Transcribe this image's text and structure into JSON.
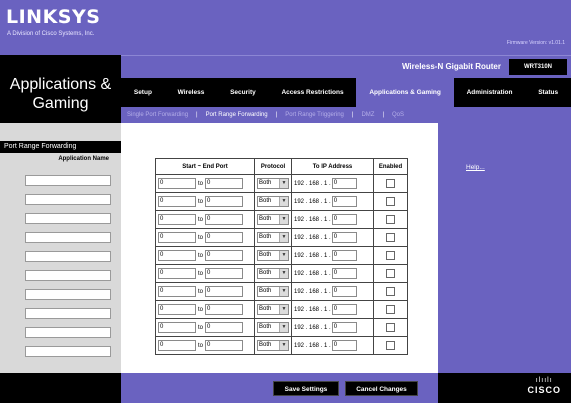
{
  "brand": {
    "logo": "LINKSYS",
    "logo_sub": "A Division of Cisco Systems, Inc.",
    "firmware": "Firmware Version: v1.01.1"
  },
  "section_title": "Applications & Gaming",
  "product": {
    "name": "Wireless-N Gigabit Router",
    "model": "WRT310N"
  },
  "tabs": [
    {
      "label": "Setup",
      "active": false
    },
    {
      "label": "Wireless",
      "active": false
    },
    {
      "label": "Security",
      "active": false
    },
    {
      "label": "Access Restrictions",
      "active": false
    },
    {
      "label": "Applications & Gaming",
      "active": true
    },
    {
      "label": "Administration",
      "active": false
    },
    {
      "label": "Status",
      "active": false
    }
  ],
  "subtabs": [
    {
      "label": "Single Port Forwarding",
      "active": false
    },
    {
      "label": "Port Range Forwarding",
      "active": true
    },
    {
      "label": "Port Range Triggering",
      "active": false
    },
    {
      "label": "DMZ",
      "active": false
    },
    {
      "label": "QoS",
      "active": false
    }
  ],
  "left": {
    "header": "Port Range Forwarding",
    "subheader": "Application Name"
  },
  "table": {
    "columns": [
      "Start ~ End Port",
      "Protocol",
      "To IP Address",
      "Enabled"
    ],
    "to_label": "to",
    "ip_prefix": "192 . 168 . 1 .",
    "rows": [
      {
        "app": "",
        "start": "0",
        "end": "0",
        "protocol": "Both",
        "ip_last": "0",
        "enabled": false
      },
      {
        "app": "",
        "start": "0",
        "end": "0",
        "protocol": "Both",
        "ip_last": "0",
        "enabled": false
      },
      {
        "app": "",
        "start": "0",
        "end": "0",
        "protocol": "Both",
        "ip_last": "0",
        "enabled": false
      },
      {
        "app": "",
        "start": "0",
        "end": "0",
        "protocol": "Both",
        "ip_last": "0",
        "enabled": false
      },
      {
        "app": "",
        "start": "0",
        "end": "0",
        "protocol": "Both",
        "ip_last": "0",
        "enabled": false
      },
      {
        "app": "",
        "start": "0",
        "end": "0",
        "protocol": "Both",
        "ip_last": "0",
        "enabled": false
      },
      {
        "app": "",
        "start": "0",
        "end": "0",
        "protocol": "Both",
        "ip_last": "0",
        "enabled": false
      },
      {
        "app": "",
        "start": "0",
        "end": "0",
        "protocol": "Both",
        "ip_last": "0",
        "enabled": false
      },
      {
        "app": "",
        "start": "0",
        "end": "0",
        "protocol": "Both",
        "ip_last": "0",
        "enabled": false
      },
      {
        "app": "",
        "start": "0",
        "end": "0",
        "protocol": "Both",
        "ip_last": "0",
        "enabled": false
      }
    ]
  },
  "help_link": "Help...",
  "buttons": {
    "save": "Save Settings",
    "cancel": "Cancel Changes"
  },
  "footer_logo": {
    "bars": "ılıılı",
    "word": "CISCO"
  },
  "colors": {
    "brand_purple": "#6a62c0",
    "black": "#000000",
    "left_gray": "#d9d9d9"
  }
}
